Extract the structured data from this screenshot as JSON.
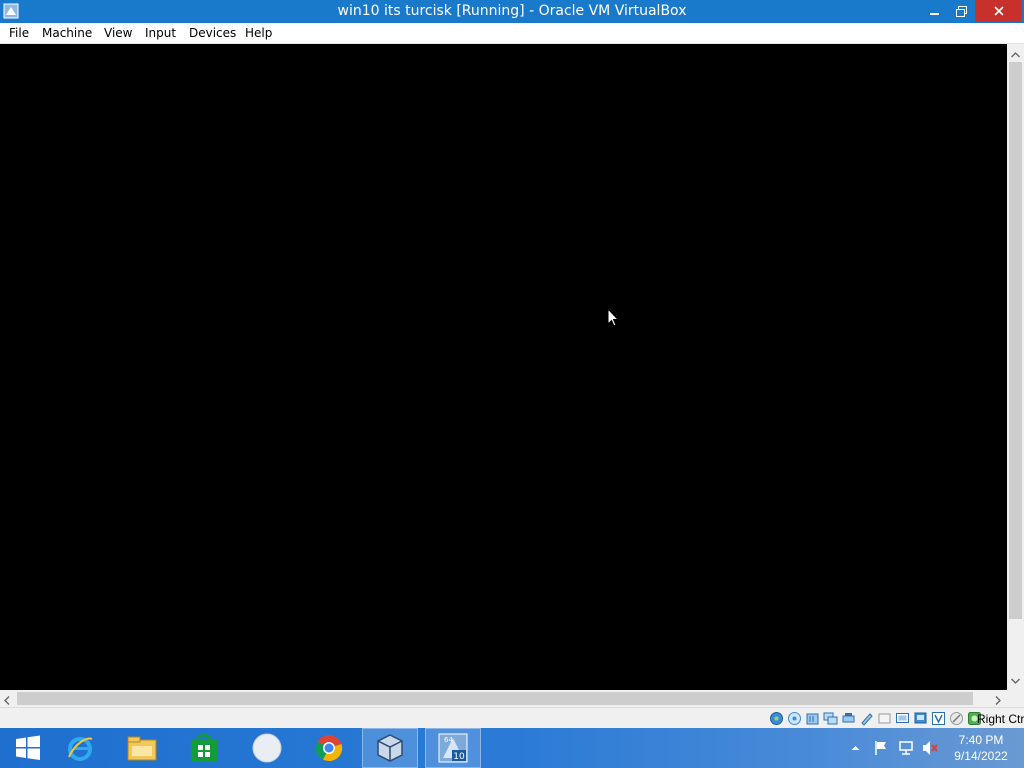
{
  "window": {
    "title": "win10 its turcisk [Running] - Oracle VM VirtualBox"
  },
  "menu": {
    "items": [
      "File",
      "Machine",
      "View",
      "Input",
      "Devices",
      "Help"
    ]
  },
  "status_bar": {
    "icons": [
      "hard-disk-icon",
      "optical-drive-icon",
      "audio-icon",
      "network-icon",
      "usb-icon",
      "shared-folders-icon",
      "display-icon",
      "video-capture-icon",
      "recording-icon",
      "virtualization-icon",
      "mouse-integration-icon",
      "keyboard-icon"
    ],
    "host_key": "Right Ctrl"
  },
  "taskbar": {
    "apps": [
      "start-button",
      "internet-explorer-icon",
      "file-explorer-icon",
      "store-icon",
      "app-icon",
      "chrome-icon",
      "virtualbox-icon",
      "win10-vm-icon"
    ],
    "time": "7:40 PM",
    "date": "9/14/2022"
  },
  "colors": {
    "titlebar": "#1979ca",
    "close_button": "#c7302b",
    "vm_screen": "#000000",
    "taskbar": "#1f6fcf"
  }
}
